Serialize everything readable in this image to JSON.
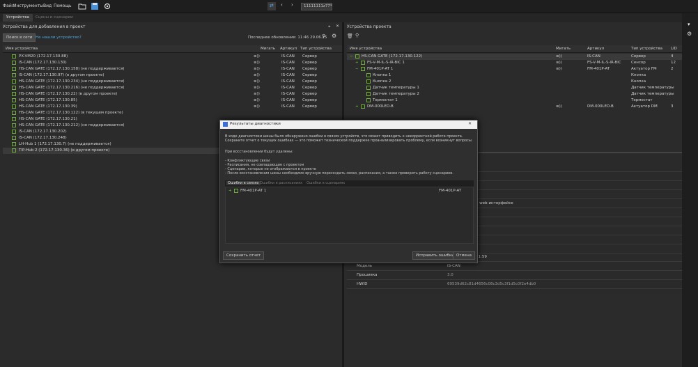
{
  "menu": {
    "items": [
      "Файл",
      "Инструменты",
      "Вид",
      "Помощь"
    ],
    "project_field": "11111111z77*"
  },
  "tabs": {
    "devices": "Устройства",
    "scenes": "Сцены и сценарии"
  },
  "left": {
    "title": "Устройства для добавления в проект",
    "search_button": "Поиск в сети",
    "not_found_link": "Не нашли устройство?",
    "last_update": "Последнее обновление: 11:46 29.06.25",
    "col_name": "Имя устройства",
    "col_blink": "Мигать",
    "col_article": "Артикул",
    "col_type": "Тип устройства",
    "rows": [
      {
        "name": "PX-VM20 (172.17.130.88)",
        "blink": "≡))",
        "article": "IS-CAN",
        "type": "Сервер"
      },
      {
        "name": "IS-CAN (172.17.130.130)",
        "blink": "≡))",
        "article": "IS-CAN",
        "type": "Сервер"
      },
      {
        "name": "HS-CAN GATE (172.17.130.158) (не поддерживается)",
        "blink": "≡))",
        "article": "IS-CAN",
        "type": "Сервер"
      },
      {
        "name": "IS-CAN (172.17.130.97) (в другом проекте)",
        "blink": "≡))",
        "article": "IS-CAN",
        "type": "Сервер"
      },
      {
        "name": "HS-CAN GATE (172.17.130.234) (не поддерживается)",
        "blink": "≡))",
        "article": "IS-CAN",
        "type": "Сервер"
      },
      {
        "name": "HS-CAN GATE (172.17.130.216) (не поддерживается)",
        "blink": "≡))",
        "article": "IS-CAN",
        "type": "Сервер"
      },
      {
        "name": "HS-CAN GATE (172.17.130.22) (в другом проекте)",
        "blink": "≡))",
        "article": "IS-CAN",
        "type": "Сервер"
      },
      {
        "name": "HS-CAN GATE (172.17.130.85)",
        "blink": "≡))",
        "article": "IS-CAN",
        "type": "Сервер"
      },
      {
        "name": "HS-CAN GATE (172.17.130.39)",
        "blink": "≡))",
        "article": "IS-CAN",
        "type": "Сервер"
      },
      {
        "name": "HS-CAN GATE (172.17.130.122) (в текущем проекте)",
        "blink": "",
        "article": "",
        "type": ""
      },
      {
        "name": "HS-CAN GATE (172.17.130.21)",
        "blink": "",
        "article": "",
        "type": ""
      },
      {
        "name": "HS-CAN GATE (172.17.130.212) (не поддерживается)",
        "blink": "",
        "article": "",
        "type": ""
      },
      {
        "name": "IS-CAN (172.17.130.202)",
        "blink": "",
        "article": "",
        "type": ""
      },
      {
        "name": "IS-CAN (172.17.130.248)",
        "blink": "",
        "article": "",
        "type": ""
      },
      {
        "name": "LH-Hub 1 (172.17.130.7) (не поддерживается)",
        "blink": "",
        "article": "",
        "type": ""
      },
      {
        "name": "TIP-Hub 2 (172.17.130.36) (в другом проекте)",
        "blink": "",
        "article": "",
        "type": ""
      }
    ]
  },
  "right": {
    "title": "Устройства проекта",
    "col_name": "Имя устройства",
    "col_blink": "Мигать",
    "col_article": "Артикул",
    "col_type": "Тип устройства",
    "col_lid": "LID",
    "rows": [
      {
        "indent": 0,
        "name": "HS-CAN GATE (172.17.130.122)",
        "blink": "≡))",
        "article": "IS-CAN",
        "type": "Сервер",
        "lid": "4"
      },
      {
        "indent": 1,
        "name": "FS-V-M-IL-S-IR-BIC 1",
        "blink": "≡))",
        "article": "FS-V-M-IL-S-IR-BIC",
        "type": "Сенсор",
        "lid": "12"
      },
      {
        "indent": 1,
        "name": "FM-401P-AT 1",
        "blink": "≡))",
        "article": "FM-401P-AT",
        "type": "Актуатор FM",
        "lid": "2"
      },
      {
        "indent": 2,
        "name": "Кнопка 1",
        "blink": "",
        "article": "",
        "type": "Кнопка",
        "lid": ""
      },
      {
        "indent": 2,
        "name": "Кнопка 2",
        "blink": "",
        "article": "",
        "type": "Кнопка",
        "lid": ""
      },
      {
        "indent": 2,
        "name": "Датчик температуры 1",
        "blink": "",
        "article": "",
        "type": "Датчик температуры",
        "lid": ""
      },
      {
        "indent": 2,
        "name": "Датчик температуры 2",
        "blink": "",
        "article": "",
        "type": "Датчик температуры",
        "lid": ""
      },
      {
        "indent": 2,
        "name": "Термостат 1",
        "blink": "",
        "article": "",
        "type": "Термостат",
        "lid": ""
      },
      {
        "indent": 1,
        "name": "DM-000LED-B",
        "blink": "≡))",
        "article": "DM-000LED-B",
        "type": "Актуатор DM",
        "lid": "3"
      }
    ],
    "props": {
      "partial_web": "о web-интерфейсе",
      "partial_time": "11:59",
      "model_label": "Модель",
      "model_value": "IS-CAN",
      "fw_label": "Прошивка",
      "fw_value": "3.0",
      "hwid_label": "HWID",
      "hwid_value": "69539d62c81d4656c08c3d5c3f1d5c0f2e4db0"
    }
  },
  "dialog": {
    "title": "Результаты диагностики",
    "intro": "В ходе диагностики шины было обнаружено ошибки в связях устройств, что может приводить к некорректной работе проекта. Сохраните отчет о текущих ошибках — это поможет технической поддержке проанализировать проблему, если возникнут вопросы.",
    "removal_title": "При восстановлении будут удалены:",
    "bullets": [
      "- Конфликтующие связи",
      "- Расписания, не совпадающие с проектом",
      "- Сценарии, которые не отображаются в проекте",
      "- После восстановления шины необходимо вручную пересоздать связи, расписания, а также проверить работу сценариев."
    ],
    "tabs": [
      "Ошибки в связях",
      "Ошибки в расписаниях",
      "Ошибки в сценариях"
    ],
    "error_row_name": "FM-401P-AT 1",
    "error_row_article": "FM-401P-AT",
    "save_report": "Сохранить отчет",
    "fix_errors": "Исправить ошибки",
    "cancel": "Отмена"
  }
}
